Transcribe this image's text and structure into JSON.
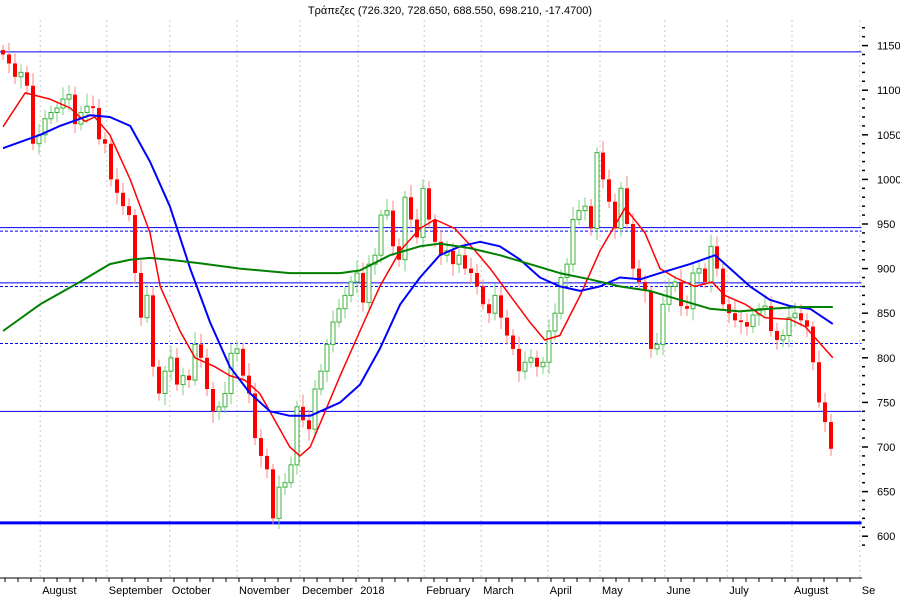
{
  "chart_data": {
    "type": "candlestick",
    "title": "Τράπεζες (726.320, 728.650, 688.550, 698.210, -17.4700)",
    "ylim": [
      580,
      1180
    ],
    "y_ticks": [
      600,
      650,
      700,
      750,
      800,
      850,
      900,
      950,
      1000,
      1050,
      1100,
      1150
    ],
    "x_labels": [
      {
        "label": "August",
        "index": 6.2
      },
      {
        "label": "September",
        "index": 17.3
      },
      {
        "label": "October",
        "index": 27.8
      },
      {
        "label": "November",
        "index": 39
      },
      {
        "label": "December",
        "index": 49.5
      },
      {
        "label": "2018",
        "index": 59.2
      },
      {
        "label": "February",
        "index": 70.2
      },
      {
        "label": "March",
        "index": 79.7
      },
      {
        "label": "April",
        "index": 90.8
      },
      {
        "label": "May",
        "index": 99.5
      },
      {
        "label": "June",
        "index": 110.3
      },
      {
        "label": "July",
        "index": 120.7
      },
      {
        "label": "August",
        "index": 131.5
      },
      {
        "label": "Se",
        "index": 142.8
      }
    ],
    "closes": [
      1140,
      1130,
      1115,
      1120,
      1105,
      1040,
      1050,
      1068,
      1075,
      1080,
      1090,
      1095,
      1062,
      1075,
      1082,
      1080,
      1045,
      1040,
      1000,
      985,
      970,
      960,
      895,
      845,
      870,
      790,
      760,
      785,
      800,
      770,
      780,
      775,
      815,
      800,
      765,
      740,
      745,
      760,
      805,
      810,
      780,
      760,
      710,
      690,
      675,
      620,
      655,
      660,
      680,
      745,
      730,
      720,
      765,
      785,
      815,
      840,
      855,
      870,
      885,
      895,
      862,
      905,
      915,
      960,
      965,
      925,
      910,
      980,
      955,
      935,
      990,
      955,
      930,
      915,
      920,
      905,
      915,
      900,
      895,
      880,
      860,
      850,
      870,
      845,
      825,
      810,
      785,
      795,
      800,
      790,
      795,
      830,
      850,
      890,
      905,
      955,
      965,
      970,
      945,
      1030,
      1000,
      975,
      945,
      990,
      950,
      900,
      885,
      875,
      810,
      815,
      860,
      880,
      885,
      858,
      855,
      895,
      900,
      885,
      925,
      900,
      860,
      850,
      842,
      840,
      835,
      848,
      855,
      858,
      830,
      820,
      825,
      845,
      850,
      842,
      835,
      795,
      750,
      728,
      698
    ],
    "first_open": 1145,
    "moving_averages": [
      {
        "name": "fast",
        "color": "#ff0000",
        "points": [
          [
            0,
            1059
          ],
          [
            3.7,
            1097
          ],
          [
            7.8,
            1090
          ],
          [
            11.2,
            1080
          ],
          [
            12.8,
            1070
          ],
          [
            13.7,
            1065
          ],
          [
            15.3,
            1070
          ],
          [
            17.8,
            1050
          ],
          [
            21.2,
            1000
          ],
          [
            24.5,
            940
          ],
          [
            26.2,
            880
          ],
          [
            29.5,
            830
          ],
          [
            32,
            800
          ],
          [
            35.3,
            790
          ],
          [
            37.8,
            780
          ],
          [
            40.3,
            775
          ],
          [
            42.8,
            760
          ],
          [
            45.3,
            730
          ],
          [
            47.8,
            700
          ],
          [
            49.5,
            690
          ],
          [
            51.2,
            700
          ],
          [
            53.7,
            740
          ],
          [
            56.2,
            780
          ],
          [
            59.5,
            830
          ],
          [
            62.8,
            880
          ],
          [
            66.2,
            920
          ],
          [
            69.5,
            945
          ],
          [
            72,
            955
          ],
          [
            75.3,
            945
          ],
          [
            78.7,
            920
          ],
          [
            81.2,
            900
          ],
          [
            84.5,
            870
          ],
          [
            87.8,
            840
          ],
          [
            90.3,
            820
          ],
          [
            92.8,
            825
          ],
          [
            96.2,
            870
          ],
          [
            99.5,
            920
          ],
          [
            103.7,
            968
          ],
          [
            107,
            940
          ],
          [
            109.5,
            900
          ],
          [
            112,
            890
          ],
          [
            115.3,
            880
          ],
          [
            118.2,
            885
          ],
          [
            120.3,
            870
          ],
          [
            123.7,
            860
          ],
          [
            127,
            845
          ],
          [
            131.2,
            843
          ],
          [
            133.7,
            835
          ],
          [
            138.3,
            800
          ]
        ]
      },
      {
        "name": "medium",
        "color": "#0000ff",
        "points": [
          [
            0,
            1035
          ],
          [
            6.2,
            1050
          ],
          [
            9.5,
            1060
          ],
          [
            14.5,
            1072
          ],
          [
            17.8,
            1070
          ],
          [
            21.2,
            1060
          ],
          [
            24.5,
            1020
          ],
          [
            27.8,
            970
          ],
          [
            31.2,
            900
          ],
          [
            34.5,
            840
          ],
          [
            37.8,
            790
          ],
          [
            41.2,
            760
          ],
          [
            44.5,
            740
          ],
          [
            47.8,
            735
          ],
          [
            51.2,
            735
          ],
          [
            56.2,
            750
          ],
          [
            59.5,
            770
          ],
          [
            62.8,
            810
          ],
          [
            66.2,
            860
          ],
          [
            69.5,
            890
          ],
          [
            72.8,
            915
          ],
          [
            76.2,
            925
          ],
          [
            79.5,
            930
          ],
          [
            82.8,
            925
          ],
          [
            86.2,
            910
          ],
          [
            89.5,
            890
          ],
          [
            92.8,
            880
          ],
          [
            96.2,
            875
          ],
          [
            99.5,
            880
          ],
          [
            102.8,
            890
          ],
          [
            106.2,
            888
          ],
          [
            109.5,
            895
          ],
          [
            114.5,
            905
          ],
          [
            118.7,
            915
          ],
          [
            121.2,
            900
          ],
          [
            124.5,
            880
          ],
          [
            127.8,
            865
          ],
          [
            131.2,
            858
          ],
          [
            134.5,
            855
          ],
          [
            138.3,
            838
          ]
        ]
      },
      {
        "name": "slow",
        "color": "#008000",
        "points": [
          [
            0,
            830
          ],
          [
            6.2,
            860
          ],
          [
            12.8,
            885
          ],
          [
            17.8,
            905
          ],
          [
            21.2,
            910
          ],
          [
            24.5,
            912
          ],
          [
            27.8,
            910
          ],
          [
            32.8,
            906
          ],
          [
            39.5,
            900
          ],
          [
            47.8,
            895
          ],
          [
            56.2,
            895
          ],
          [
            59.5,
            898
          ],
          [
            64.5,
            915
          ],
          [
            69.5,
            925
          ],
          [
            72.8,
            928
          ],
          [
            77.8,
            923
          ],
          [
            82.8,
            915
          ],
          [
            87.8,
            905
          ],
          [
            92.8,
            895
          ],
          [
            97.8,
            888
          ],
          [
            102.8,
            880
          ],
          [
            107.8,
            875
          ],
          [
            112.8,
            865
          ],
          [
            117.8,
            855
          ],
          [
            122.8,
            852
          ],
          [
            127.8,
            855
          ],
          [
            132.8,
            857
          ],
          [
            138.3,
            857
          ]
        ]
      }
    ],
    "horizontal_lines": [
      {
        "value": 1143,
        "style": "solid"
      },
      {
        "value": 946,
        "style": "solid"
      },
      {
        "value": 942,
        "style": "dotted"
      },
      {
        "value": 884,
        "style": "solid"
      },
      {
        "value": 880,
        "style": "dotted"
      },
      {
        "value": 816,
        "style": "dotted"
      },
      {
        "value": 740,
        "style": "solid"
      },
      {
        "value": 615,
        "style": "thick"
      }
    ],
    "colors": {
      "up": "#3cb03c",
      "down": "#ff0000",
      "level": "#0000ff",
      "grid": "#c8c8c8"
    }
  }
}
